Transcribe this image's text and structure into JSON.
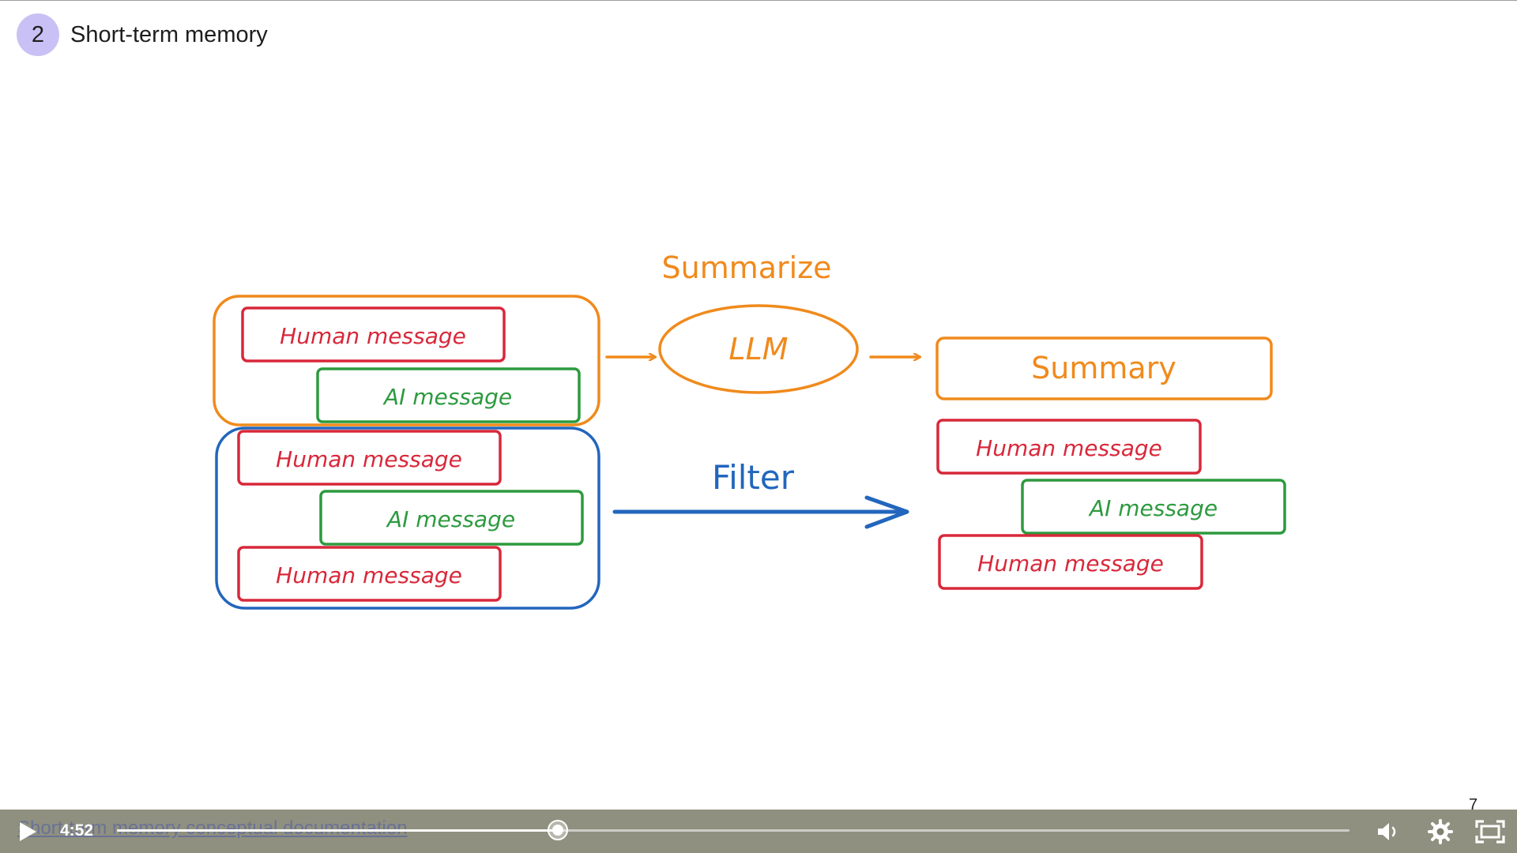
{
  "header": {
    "lesson_number": "2",
    "title": "Short-term memory"
  },
  "diagram": {
    "summarize_label": "Summarize",
    "llm_label": "LLM",
    "summary_label": "Summary",
    "filter_label": "Filter",
    "human_message": "Human message",
    "ai_message": "AI message",
    "colors": {
      "orange": "#f08a1c",
      "blue": "#2266bd",
      "red": "#d8283a",
      "green": "#2d9a3f"
    }
  },
  "slide": {
    "page_number": "7"
  },
  "player": {
    "link_text": "Short-term memory conceptual documentation",
    "time": "4:52",
    "progress": 0.3577,
    "icons": [
      "play-icon",
      "volume-icon",
      "settings-gear-icon",
      "fullscreen-icon"
    ]
  }
}
